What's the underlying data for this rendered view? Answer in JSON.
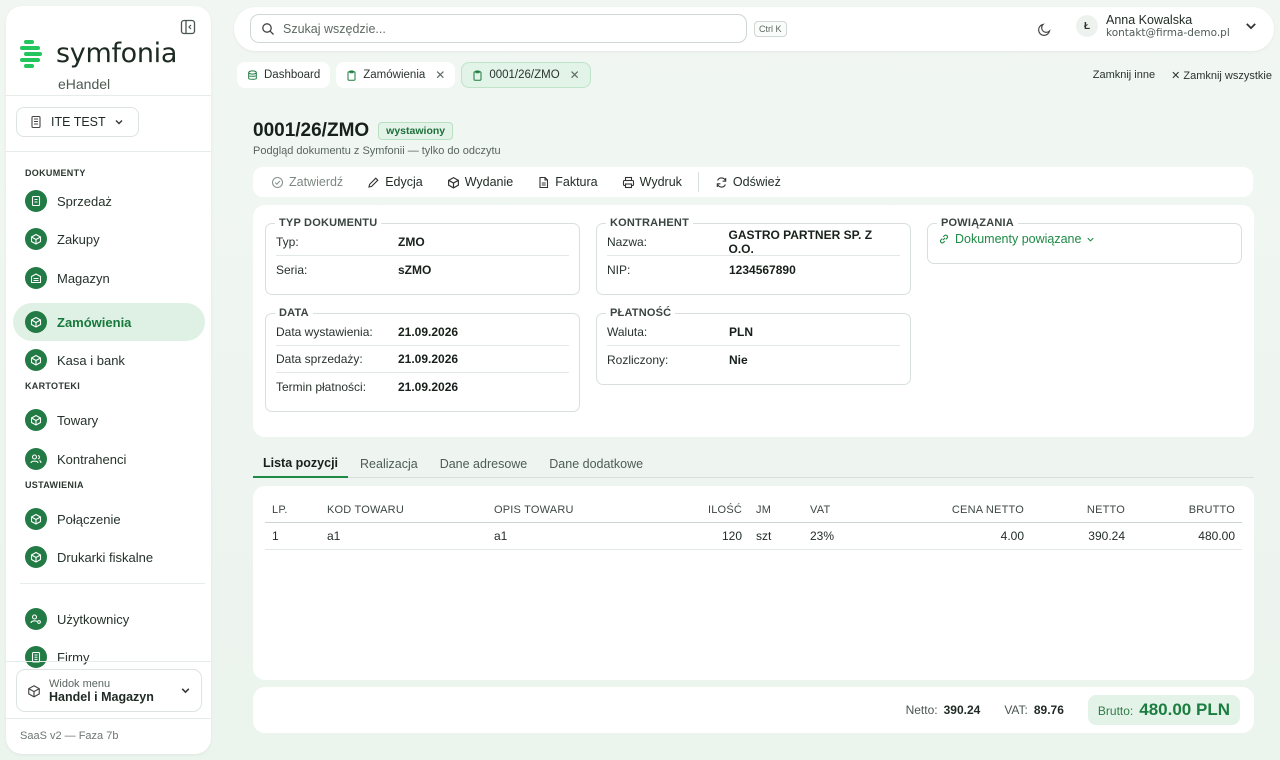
{
  "app": {
    "brand": "symfonia",
    "product": "eHandel",
    "version_label": "SaaS v2 — Faza 7b"
  },
  "company": {
    "name": "ITE TEST"
  },
  "sidebar": {
    "sections": [
      {
        "title": "DOKUMENTY"
      },
      {
        "title": "KARTOTEKI"
      },
      {
        "title": "USTAWIENIA"
      }
    ],
    "items": [
      {
        "label": "Sprzedaż",
        "icon": "receipt-icon"
      },
      {
        "label": "Zakupy",
        "icon": "box-icon"
      },
      {
        "label": "Magazyn",
        "icon": "warehouse-icon"
      },
      {
        "label": "Zamówienia",
        "icon": "box-icon",
        "active": true
      },
      {
        "label": "Kasa i bank",
        "icon": "box-icon"
      },
      {
        "label": "Towary",
        "icon": "box-icon"
      },
      {
        "label": "Kontrahenci",
        "icon": "users-icon"
      },
      {
        "label": "Połączenie",
        "icon": "box-icon"
      },
      {
        "label": "Drukarki fiskalne",
        "icon": "box-icon"
      },
      {
        "label": "Użytkownicy",
        "icon": "user-cog-icon"
      },
      {
        "label": "Firmy",
        "icon": "building-icon"
      }
    ],
    "menu_view": {
      "label": "Widok menu",
      "value": "Handel i Magazyn"
    }
  },
  "header": {
    "search_placeholder": "Szukaj wszędzie...",
    "shortcut": "Ctrl K",
    "user": {
      "initial": "Ł",
      "name": "Anna Kowalska",
      "email": "kontakt@firma-demo.pl"
    }
  },
  "tabs": [
    {
      "label": "Dashboard",
      "closable": false
    },
    {
      "label": "Zamówienia",
      "closable": true
    },
    {
      "label": "0001/26/ZMO",
      "closable": true,
      "active": true
    }
  ],
  "tab_actions": {
    "close_others": "Zamknij inne",
    "close_all": "Zamknij wszystkie"
  },
  "document": {
    "number": "0001/26/ZMO",
    "status": "wystawiony",
    "subtitle": "Podgląd dokumentu z Symfonii — tylko do odczytu"
  },
  "toolbar": {
    "approve": "Zatwierdź",
    "edit": "Edycja",
    "issue": "Wydanie",
    "invoice": "Faktura",
    "print": "Wydruk",
    "refresh": "Odśwież"
  },
  "sections": {
    "type": {
      "title": "TYP DOKUMENTU",
      "rows": [
        {
          "k": "Typ:",
          "v": "ZMO"
        },
        {
          "k": "Seria:",
          "v": "sZMO"
        }
      ]
    },
    "contractor": {
      "title": "KONTRAHENT",
      "rows": [
        {
          "k": "Nazwa:",
          "v": "GASTRO PARTNER SP. Z O.O."
        },
        {
          "k": "NIP:",
          "v": "1234567890"
        }
      ]
    },
    "links": {
      "title": "POWIĄZANIA",
      "button": "Dokumenty powiązane"
    },
    "date": {
      "title": "DATA",
      "rows": [
        {
          "k": "Data wystawienia:",
          "v": "21.09.2026"
        },
        {
          "k": "Data sprzedaży:",
          "v": "21.09.2026"
        },
        {
          "k": "Termin płatności:",
          "v": "21.09.2026"
        }
      ]
    },
    "payment": {
      "title": "PŁATNOŚĆ",
      "rows": [
        {
          "k": "Waluta:",
          "v": "PLN"
        },
        {
          "k": "Rozliczony:",
          "v": "Nie"
        }
      ]
    }
  },
  "subtabs": [
    "Lista pozycji",
    "Realizacja",
    "Dane adresowe",
    "Dane dodatkowe"
  ],
  "table": {
    "headers": [
      "LP.",
      "KOD TOWARU",
      "OPIS TOWARU",
      "ILOŚĆ",
      "JM",
      "VAT",
      "CENA NETTO",
      "NETTO",
      "BRUTTO"
    ],
    "rows": [
      [
        "1",
        "a1",
        "a1",
        "120",
        "szt",
        "23%",
        "4.00",
        "390.24",
        "480.00"
      ]
    ]
  },
  "totals": {
    "netto_label": "Netto:",
    "netto": "390.24",
    "vat_label": "VAT:",
    "vat": "89.76",
    "brutto_label": "Brutto:",
    "brutto": "480.00 PLN"
  },
  "colors": {
    "accent": "#1e8a45",
    "brand": "#22c55e",
    "active_bg": "#dff1e4"
  }
}
